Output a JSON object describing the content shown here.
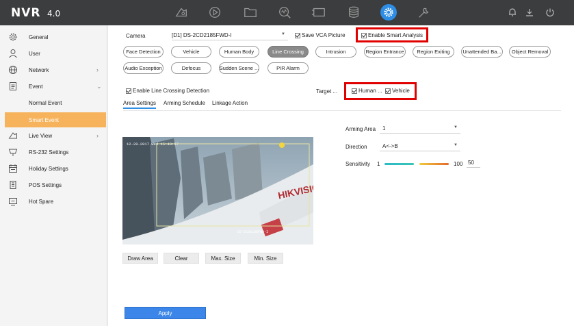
{
  "app": {
    "logo": "NVR",
    "version": "4.0"
  },
  "topbar": {
    "icons": [
      "live-view-icon",
      "playback-icon",
      "file-management-icon",
      "smart-analysis-icon",
      "camera-icon",
      "storage-icon",
      "configuration-icon",
      "maintenance-icon"
    ],
    "active": "configuration-icon",
    "right_icons": [
      "alarm-bell-icon",
      "download-icon",
      "power-icon"
    ],
    "accent": "#2e8de4"
  },
  "sidebar": {
    "items": [
      {
        "label": "General",
        "icon": "gear-icon"
      },
      {
        "label": "User",
        "icon": "user-icon"
      },
      {
        "label": "Network",
        "icon": "globe-icon",
        "chevron": "›"
      },
      {
        "label": "Event",
        "icon": "event-icon",
        "chevron": "⌄"
      },
      {
        "label": "Normal Event"
      },
      {
        "label": "Smart Event",
        "active": true
      },
      {
        "label": "Live View",
        "icon": "live-view-icon",
        "chevron": "›"
      },
      {
        "label": "RS-232 Settings",
        "icon": "rs232-icon"
      },
      {
        "label": "Holiday Settings",
        "icon": "calendar-icon"
      },
      {
        "label": "POS Settings",
        "icon": "pos-icon"
      },
      {
        "label": "Hot Spare",
        "icon": "hot-spare-icon"
      }
    ],
    "active_color": "#f7b35b"
  },
  "main": {
    "camera_label": "Camera",
    "camera_value": "[D1] DS-2CD2185FWD-I",
    "save_vca_label": "Save VCA Picture",
    "enable_smart_label": "Enable Smart Analysis",
    "events_row1": [
      "Face Detection",
      "Vehicle",
      "Human Body",
      "Line Crossing",
      "Intrusion",
      "Region Entrance",
      "Region Exiting",
      "Unattended Ba...",
      "Object Removal"
    ],
    "events_row2": [
      "Audio Exception",
      "Defocus",
      "Sudden Scene ...",
      "PIR Alarm"
    ],
    "active_event": "Line Crossing",
    "enable_line_label": "Enable Line Crossing Detection",
    "target_label": "Target ...",
    "target_human": "Human ...",
    "target_vehicle": "Vehicle",
    "tabs": [
      "Area Settings",
      "Arming Schedule",
      "Linkage Action"
    ],
    "video_osd_top": "12-20-2017 Wed 15:48:37",
    "video_osd_bottom": "DS-2CD2185FWD-I",
    "video_brand": "HIKVISION",
    "video_buttons": [
      "Draw Area",
      "Clear",
      "Max. Size",
      "Min. Size"
    ],
    "arming_area_label": "Arming Area",
    "arming_area_value": "1",
    "direction_label": "Direction",
    "direction_value": "A<->B",
    "sensitivity_label": "Sensitivity",
    "sensitivity_min": "1",
    "sensitivity_max": "100",
    "sensitivity_value": "50",
    "apply_label": "Apply"
  },
  "highlight_color": "#e10000"
}
